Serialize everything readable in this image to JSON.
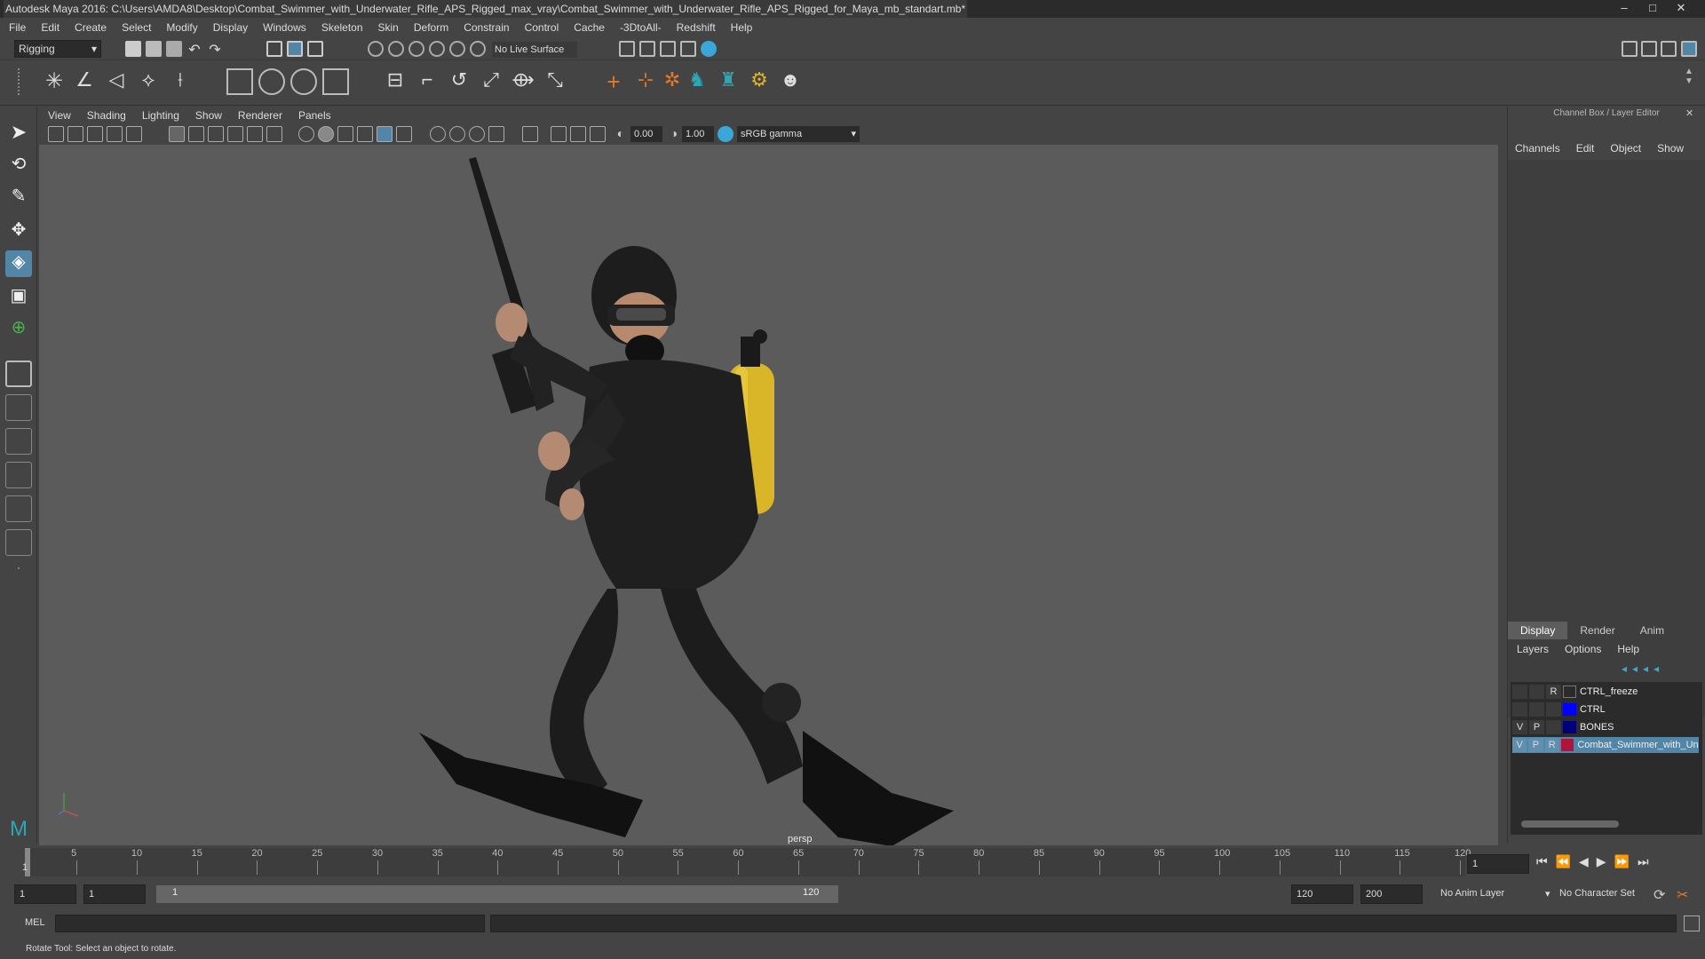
{
  "window": {
    "title": "Autodesk Maya 2016: C:\\Users\\AMDA8\\Desktop\\Combat_Swimmer_with_Underwater_Rifle_APS_Rigged_max_vray\\Combat_Swimmer_with_Underwater_Rifle_APS_Rigged_for_Maya_mb_standart.mb*",
    "minimize": "–",
    "maximize": "□",
    "close": "✕"
  },
  "menubar": [
    "File",
    "Edit",
    "Create",
    "Select",
    "Modify",
    "Display",
    "Windows",
    "Skeleton",
    "Skin",
    "Deform",
    "Constrain",
    "Control",
    "Cache",
    "-3DtoAll-",
    "Redshift",
    "Help"
  ],
  "statusline": {
    "mode": "Rigging",
    "live_surface": "No Live Surface"
  },
  "viewport": {
    "menu": [
      "View",
      "Shading",
      "Lighting",
      "Show",
      "Renderer",
      "Panels"
    ],
    "value_a": "0.00",
    "value_b": "1.00",
    "color_space": "sRGB gamma",
    "camera_label": "persp"
  },
  "channelbox": {
    "title": "Channel Box / Layer Editor",
    "menu": [
      "Channels",
      "Edit",
      "Object",
      "Show"
    ],
    "tabs": [
      "Display",
      "Render",
      "Anim"
    ],
    "layer_menu": [
      "Layers",
      "Options",
      "Help"
    ],
    "layers": [
      {
        "v": "",
        "p": "",
        "r": "R",
        "color": "#444444",
        "name": "CTRL_freeze"
      },
      {
        "v": "",
        "p": "",
        "r": "",
        "color": "#0000ff",
        "name": "CTRL"
      },
      {
        "v": "V",
        "p": "P",
        "r": "",
        "color": "#00007a",
        "name": "BONES"
      },
      {
        "v": "V",
        "p": "P",
        "r": "R",
        "color": "#b0143c",
        "name": "Combat_Swimmer_with_Und"
      }
    ]
  },
  "timeline": {
    "ticks": [
      "5",
      "10",
      "15",
      "20",
      "25",
      "30",
      "35",
      "40",
      "45",
      "50",
      "55",
      "60",
      "65",
      "70",
      "75",
      "80",
      "85",
      "90",
      "95",
      "100",
      "105",
      "110",
      "115",
      "120"
    ],
    "current_frame_marker": "1",
    "current_frame": "1"
  },
  "range": {
    "start": "1",
    "inner_start": "1",
    "slider_start": "1",
    "slider_end": "120",
    "end": "120",
    "anim_end": "200",
    "anim_layer": "No Anim Layer",
    "character_set": "No Character Set"
  },
  "command": {
    "language": "MEL"
  },
  "status": {
    "help_line": "Rotate Tool: Select an object to rotate."
  },
  "colors": {
    "accent": "#5285a6",
    "tank": "#d8b628",
    "suit": "#222222"
  }
}
